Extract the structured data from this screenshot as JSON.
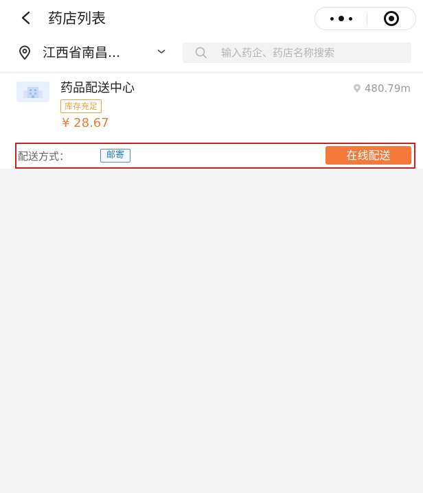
{
  "nav": {
    "title": "药店列表",
    "back_icon": "chevron-left-icon",
    "more_icon": "more-dots-icon",
    "target_icon": "record-target-icon"
  },
  "filter": {
    "location": "江西省南昌...",
    "search_placeholder": "输入药企、药店名称搜索"
  },
  "store": {
    "name": "药品配送中心",
    "distance": "480.79m",
    "stock_badge": "库存充足",
    "price": "¥ 28.67",
    "delivery_label": "配送方式：",
    "delivery_tag": "邮寄",
    "online_button": "在线配送"
  },
  "colors": {
    "accent_orange": "#f47a3c",
    "price_orange": "#e87e3a",
    "badge_orange": "#e8a43e",
    "tag_blue": "#4a90d9",
    "highlight_red": "#c82323"
  }
}
